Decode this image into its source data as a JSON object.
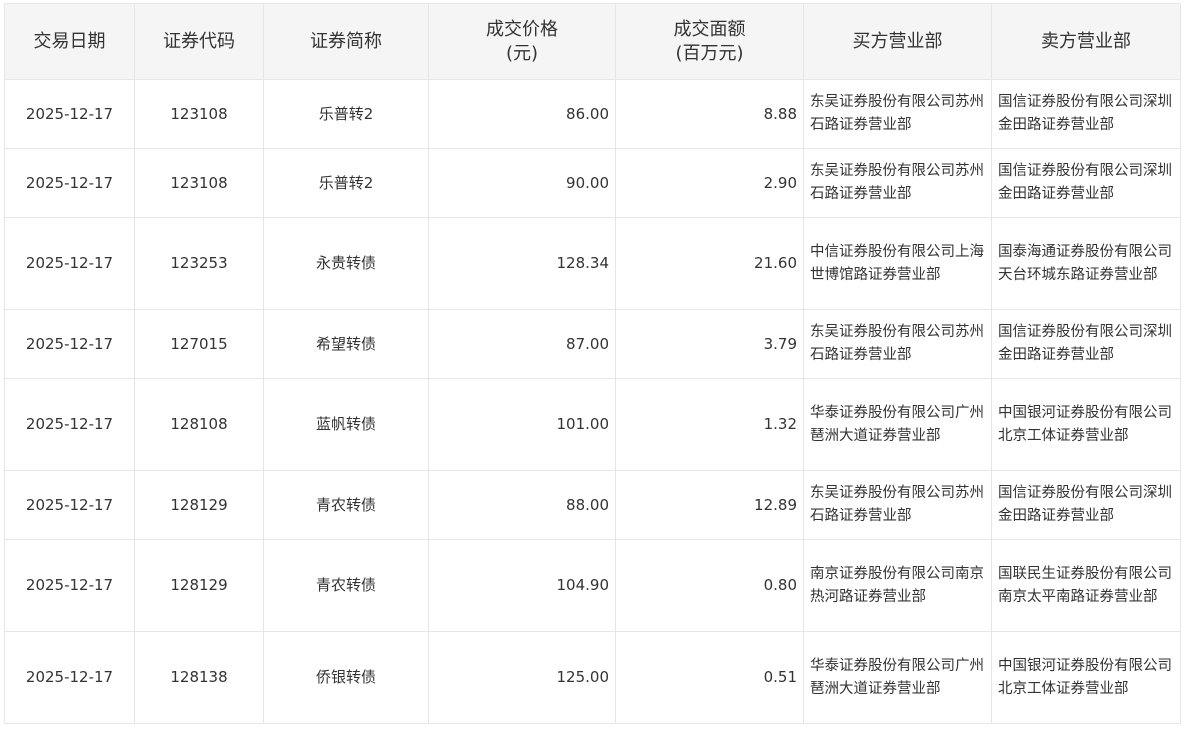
{
  "table": {
    "headers": [
      {
        "lines": [
          "交易日期"
        ]
      },
      {
        "lines": [
          "证券代码"
        ]
      },
      {
        "lines": [
          "证券简称"
        ]
      },
      {
        "lines": [
          "成交价格",
          "(元)"
        ]
      },
      {
        "lines": [
          "成交面额",
          "(百万元)"
        ]
      },
      {
        "lines": [
          "买方营业部"
        ]
      },
      {
        "lines": [
          "卖方营业部"
        ]
      }
    ],
    "rows": [
      {
        "date": "2025-12-17",
        "code": "123108",
        "name": "乐普转2",
        "price": "86.00",
        "amount": "8.88",
        "buyer": "东吴证券股份有限公司苏州石路证券营业部",
        "seller": "国信证券股份有限公司深圳金田路证券营业部"
      },
      {
        "date": "2025-12-17",
        "code": "123108",
        "name": "乐普转2",
        "price": "90.00",
        "amount": "2.90",
        "buyer": "东吴证券股份有限公司苏州石路证券营业部",
        "seller": "国信证券股份有限公司深圳金田路证券营业部"
      },
      {
        "date": "2025-12-17",
        "code": "123253",
        "name": "永贵转债",
        "price": "128.34",
        "amount": "21.60",
        "buyer": "中信证券股份有限公司上海世博馆路证券营业部",
        "seller": "国泰海通证券股份有限公司天台环城东路证券营业部"
      },
      {
        "date": "2025-12-17",
        "code": "127015",
        "name": "希望转债",
        "price": "87.00",
        "amount": "3.79",
        "buyer": "东吴证券股份有限公司苏州石路证券营业部",
        "seller": "国信证券股份有限公司深圳金田路证券营业部"
      },
      {
        "date": "2025-12-17",
        "code": "128108",
        "name": "蓝帆转债",
        "price": "101.00",
        "amount": "1.32",
        "buyer": "华泰证券股份有限公司广州琶洲大道证券营业部",
        "seller": "中国银河证券股份有限公司北京工体证券营业部"
      },
      {
        "date": "2025-12-17",
        "code": "128129",
        "name": "青农转债",
        "price": "88.00",
        "amount": "12.89",
        "buyer": "东吴证券股份有限公司苏州石路证券营业部",
        "seller": "国信证券股份有限公司深圳金田路证券营业部"
      },
      {
        "date": "2025-12-17",
        "code": "128129",
        "name": "青农转债",
        "price": "104.90",
        "amount": "0.80",
        "buyer": "南京证券股份有限公司南京热河路证券营业部",
        "seller": "国联民生证券股份有限公司南京太平南路证券营业部"
      },
      {
        "date": "2025-12-17",
        "code": "128138",
        "name": "侨银转债",
        "price": "125.00",
        "amount": "0.51",
        "buyer": "华泰证券股份有限公司广州琶洲大道证券营业部",
        "seller": "中国银河证券股份有限公司北京工体证券营业部"
      }
    ]
  },
  "colors": {
    "header_bg": "#f5f5f5",
    "border": "#e6e6e6",
    "text": "#333333"
  }
}
